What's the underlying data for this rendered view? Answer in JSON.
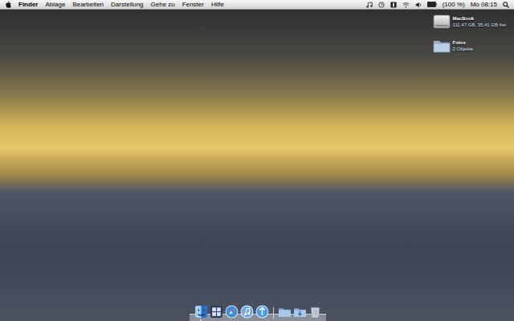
{
  "menubar": {
    "app": "Finder",
    "menus": [
      "Ablage",
      "Bearbeiten",
      "Darstellung",
      "Gehe zu",
      "Fenster",
      "Hilfe"
    ],
    "battery": "(100 %)",
    "clock": "Mo 08:15"
  },
  "desktop_icons": [
    {
      "label": "MacBook",
      "info": "111,47 GB, 35,41 GB frei",
      "kind": "drive"
    },
    {
      "label": "Fotos",
      "info": "2 Objekte",
      "kind": "folder"
    }
  ],
  "dock": {
    "items": [
      {
        "kind": "finder",
        "running": true
      },
      {
        "kind": "spaces",
        "running": false
      },
      {
        "kind": "safari",
        "running": false
      },
      {
        "kind": "itunes",
        "running": false
      },
      {
        "kind": "mail",
        "running": false
      },
      {
        "kind": "separator",
        "running": false
      },
      {
        "kind": "folder",
        "running": false
      },
      {
        "kind": "downloads",
        "running": false
      },
      {
        "kind": "trash",
        "running": false
      }
    ]
  }
}
